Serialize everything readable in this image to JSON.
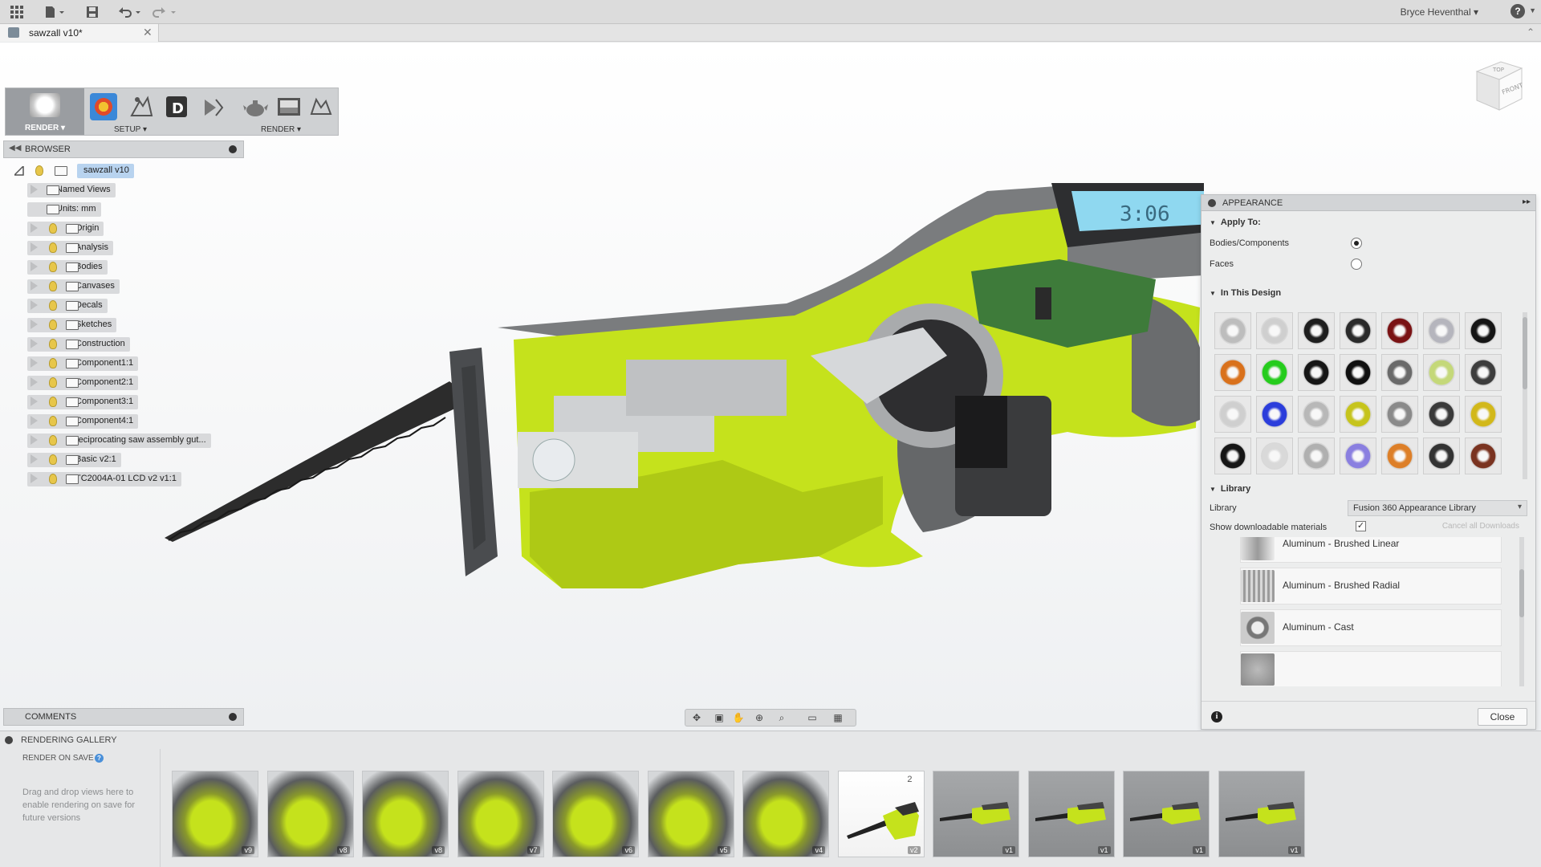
{
  "topbar": {
    "apps_icon": "grid-icon",
    "file_icon": "file-icon",
    "save_icon": "save-icon",
    "undo_icon": "undo-icon",
    "redo_icon": "redo-icon",
    "user": "Bryce Heventhal",
    "help": "?"
  },
  "document_tab": {
    "title": "sawzall v10*",
    "close": "✕"
  },
  "ribbon": {
    "workspace": "RENDER",
    "setup_label": "SETUP",
    "render_label": "RENDER"
  },
  "browser": {
    "title": "BROWSER",
    "root": "sawzall v10",
    "items": [
      {
        "label": "Named Views",
        "bulb": false
      },
      {
        "label": "Units: mm",
        "bulb": false
      },
      {
        "label": "Origin",
        "bulb": true
      },
      {
        "label": "Analysis",
        "bulb": true
      },
      {
        "label": "Bodies",
        "bulb": true
      },
      {
        "label": "Canvases",
        "bulb": true
      },
      {
        "label": "Decals",
        "bulb": true
      },
      {
        "label": "Sketches",
        "bulb": true
      },
      {
        "label": "Construction",
        "bulb": true
      },
      {
        "label": "Component1:1",
        "bulb": true
      },
      {
        "label": "Component2:1",
        "bulb": true
      },
      {
        "label": "Component3:1",
        "bulb": true
      },
      {
        "label": "Component4:1",
        "bulb": true
      },
      {
        "label": "reciprocating saw assembly gut...",
        "bulb": true
      },
      {
        "label": "Basic v2:1",
        "bulb": true
      },
      {
        "label": "TC2004A-01 LCD  v2 v1:1",
        "bulb": true
      }
    ]
  },
  "viewcube": {
    "top": "TOP",
    "front": "FRONT"
  },
  "appearance": {
    "title": "APPEARANCE",
    "apply_to": "Apply To:",
    "option_bodies": "Bodies/Components",
    "option_faces": "Faces",
    "in_this_design": "In This Design",
    "library_section": "Library",
    "library_label": "Library",
    "library_value": "Fusion 360 Appearance Library",
    "show_downloadable": "Show downloadable materials",
    "show_downloadable_checked": true,
    "cancel_downloads": "Cancel all Downloads",
    "materials": [
      "Aluminum - Brushed Linear",
      "Aluminum - Brushed Radial",
      "Aluminum - Cast"
    ],
    "close": "Close",
    "info": "i",
    "swatch_colors": [
      [
        "#bdbdbd",
        "#cfcfcf",
        "#1e1e1e",
        "#2a2a2a",
        "#7a1214",
        "#b5b5bd",
        "#161616"
      ],
      [
        "#d9711c",
        "#25cc1c",
        "#161616",
        "#101010",
        "#6a6a6a",
        "#c4d879",
        "#3d3d3d"
      ],
      [
        "#cfcfcf",
        "#2b3ddb",
        "#b8b8b8",
        "#c6c41c",
        "#8a8a8a",
        "#3a3a3a",
        "#d2b81a"
      ],
      [
        "#151515",
        "#d9d9d9",
        "#b0b0b0",
        "#8a7fe0",
        "#dd7f28",
        "#333333",
        "#7a3320"
      ]
    ]
  },
  "comments": {
    "title": "COMMENTS"
  },
  "gallery": {
    "title": "RENDERING GALLERY",
    "render_on_save": "RENDER ON SAVE",
    "hint": "Drag and drop views here to enable rendering on save for future versions",
    "thumbnails": [
      {
        "version": "v9",
        "kind": "cutaway"
      },
      {
        "version": "v8",
        "kind": "cutaway"
      },
      {
        "version": "v8",
        "kind": "cutaway"
      },
      {
        "version": "v7",
        "kind": "cutaway"
      },
      {
        "version": "v6",
        "kind": "cutaway"
      },
      {
        "version": "v5",
        "kind": "cutaway"
      },
      {
        "version": "v4",
        "kind": "cutaway"
      },
      {
        "version": "v2",
        "kind": "full-white",
        "count": "2"
      },
      {
        "version": "v1",
        "kind": "side-gray"
      },
      {
        "version": "v1",
        "kind": "angle-gray"
      },
      {
        "version": "v1",
        "kind": "top-gray"
      },
      {
        "version": "v1",
        "kind": "front-gray"
      }
    ]
  },
  "colors": {
    "model_green": "#c5e21c",
    "selection_blue": "#b8d3ef",
    "panel_gray": "#d3d5d7"
  }
}
